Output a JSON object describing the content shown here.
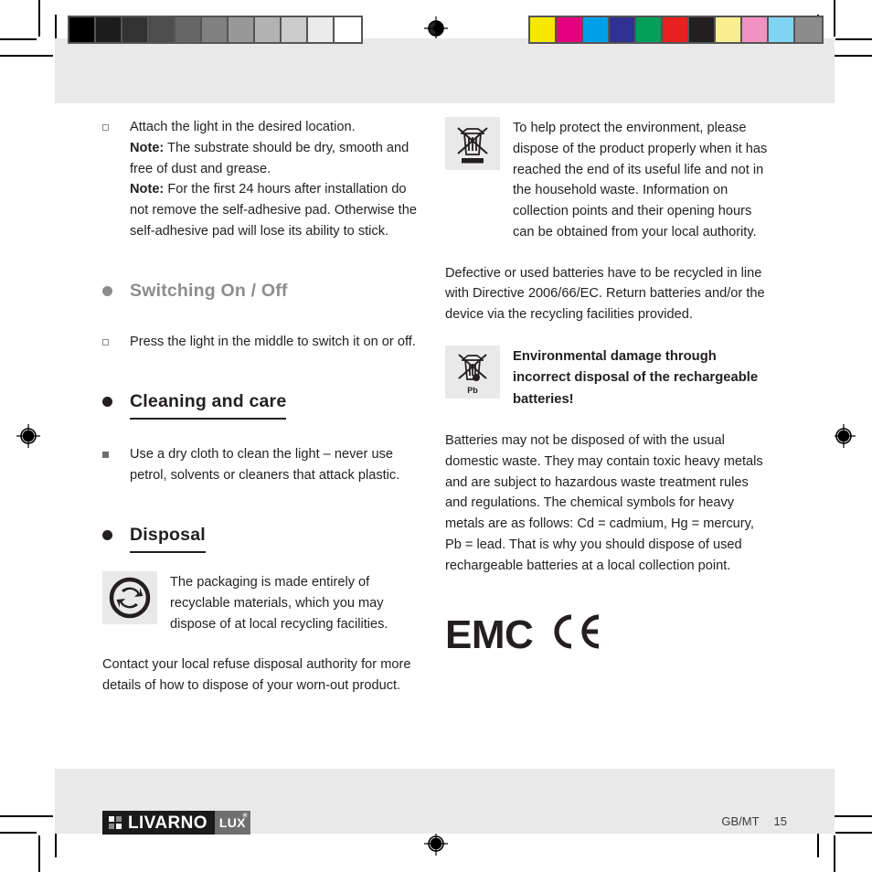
{
  "print_marks": {
    "gray_bar": {
      "name": "grayscale-calibration-bar",
      "swatches": [
        "#000000",
        "#1c1c1c",
        "#333333",
        "#4d4d4d",
        "#666666",
        "#808080",
        "#999999",
        "#b3b3b3",
        "#cccccc",
        "#ebebeb",
        "#ffffff"
      ]
    },
    "color_bar": {
      "name": "color-calibration-bar",
      "swatches": [
        "#f7e800",
        "#e4007f",
        "#00a0e9",
        "#2e3192",
        "#00a05a",
        "#e8201f",
        "#231f20",
        "#faee91",
        "#f291c3",
        "#7fd4f3",
        "#8c8c8c"
      ]
    }
  },
  "left_column": {
    "install_item": {
      "line1": "Attach the light in the desired location.",
      "note1_label": "Note:",
      "note1_text": " The substrate should be dry, smooth and free of dust and grease.",
      "note2_label": "Note:",
      "note2_text": " For the first 24 hours after installation do not remove the self-adhesive pad. Otherwise the self-adhesive pad will lose its ability to stick."
    },
    "switching_heading": "Switching On / Off",
    "switching_item": "Press the light in the middle to switch it on or off.",
    "cleaning_heading": "Cleaning and care",
    "cleaning_item": "Use a dry cloth to clean the light – never use petrol, solvents or cleaners that attack plastic.",
    "disposal_heading": "Disposal",
    "packaging_text": "The packaging is made entirely of recyclable materials, which you may dispose of at local recycling facilities.",
    "refuse_text": "Contact your local refuse disposal authority for more details of how to dispose of your worn-out product."
  },
  "right_column": {
    "weee_text": "To help protect the environment, please dispose of the product properly when it has reached the end of its useful life and not in the household waste. Information on collection points and their opening hours can be obtained from your local authority.",
    "battery_directive_text": "Defective or used batteries have to be recycled in line with Directive 2006/66/EC. Return batteries and/or the device via the recycling facilities provided.",
    "pb_icon_label": "Pb",
    "env_damage_heading": "Environmental damage through incorrect disposal of the rechargeable batteries!",
    "batteries_text": "Batteries may not be disposed of with the usual domestic waste. They may contain toxic heavy metals and are subject to hazardous waste treatment rules and regulations. The chemical symbols for heavy metals are as follows: Cd = cadmium, Hg = mercury, Pb = lead. That is why you should dispose of used rechargeable batteries at a local collection point.",
    "emc_label": "EMC"
  },
  "footer": {
    "logo_word": "LIVARNO",
    "logo_suffix": "LUX",
    "logo_star": "✳",
    "locale": "GB/MT",
    "page_number": "15"
  }
}
